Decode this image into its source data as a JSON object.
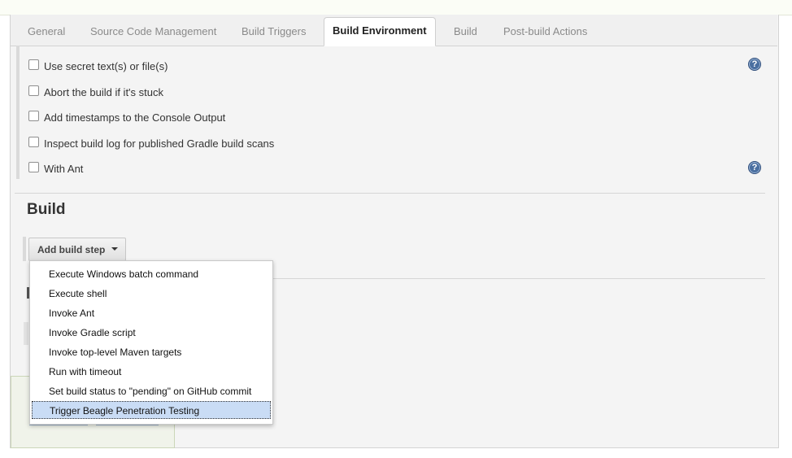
{
  "tabs": [
    {
      "label": "General"
    },
    {
      "label": "Source Code Management"
    },
    {
      "label": "Build Triggers"
    },
    {
      "label": "Build Environment",
      "active": true
    },
    {
      "label": "Build"
    },
    {
      "label": "Post-build Actions"
    }
  ],
  "build_environment": {
    "options": [
      {
        "label": "Use secret text(s) or file(s)",
        "checked": false,
        "has_help": true
      },
      {
        "label": "Abort the build if it's stuck",
        "checked": false
      },
      {
        "label": "Add timestamps to the Console Output",
        "checked": false
      },
      {
        "label": "Inspect build log for published Gradle build scans",
        "checked": false
      },
      {
        "label": "With Ant",
        "checked": false,
        "has_help": true
      }
    ],
    "help_glyph": "?"
  },
  "build": {
    "title": "Build",
    "add_step_label": "Add build step",
    "menu_items": [
      "Execute Windows batch command",
      "Execute shell",
      "Invoke Ant",
      "Invoke Gradle script",
      "Invoke top-level Maven targets",
      "Run with timeout",
      "Set build status to \"pending\" on GitHub commit",
      "Trigger Beagle Penetration Testing"
    ],
    "selected_item": "Trigger Beagle Penetration Testing"
  },
  "icons": {
    "help": "help-icon",
    "dropdown": "caret-down-icon",
    "checkbox": "checkbox-icon"
  },
  "colors": {
    "help_icon": "#4a6fa0",
    "selected_menu_item": "#c9dcf5",
    "active_tab_bg": "#ffffff"
  }
}
